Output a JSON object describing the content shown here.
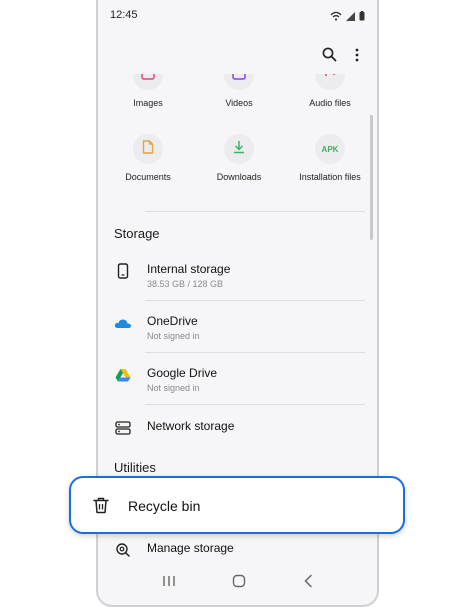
{
  "status_bar": {
    "time": "12:45"
  },
  "categories": [
    {
      "label": "Images",
      "icon": "image-icon",
      "color": "#e0457b"
    },
    {
      "label": "Videos",
      "icon": "video-icon",
      "color": "#8a3ff0"
    },
    {
      "label": "Audio files",
      "icon": "audio-icon",
      "color": "#e0453e"
    },
    {
      "label": "Documents",
      "icon": "document-icon",
      "color": "#e8a33b"
    },
    {
      "label": "Downloads",
      "icon": "download-icon",
      "color": "#3bb36a"
    },
    {
      "label": "Installation files",
      "icon": "apk-icon",
      "badge": "APK",
      "color": "#38b25a"
    }
  ],
  "storage": {
    "title": "Storage",
    "items": [
      {
        "title": "Internal storage",
        "subtitle": "38.53 GB / 128 GB",
        "icon": "phone-icon"
      },
      {
        "title": "OneDrive",
        "subtitle": "Not signed in",
        "icon": "onedrive-icon"
      },
      {
        "title": "Google Drive",
        "subtitle": "Not signed in",
        "icon": "google-drive-icon"
      },
      {
        "title": "Network storage",
        "subtitle": "",
        "icon": "network-storage-icon"
      }
    ]
  },
  "utilities": {
    "title": "Utilities",
    "items": [
      {
        "title": "Recycle bin",
        "icon": "trash-icon"
      },
      {
        "title": "Manage storage",
        "icon": "manage-storage-icon"
      }
    ]
  },
  "colors": {
    "highlight_border": "#1a6fe0",
    "onedrive": "#1e8bdf"
  }
}
